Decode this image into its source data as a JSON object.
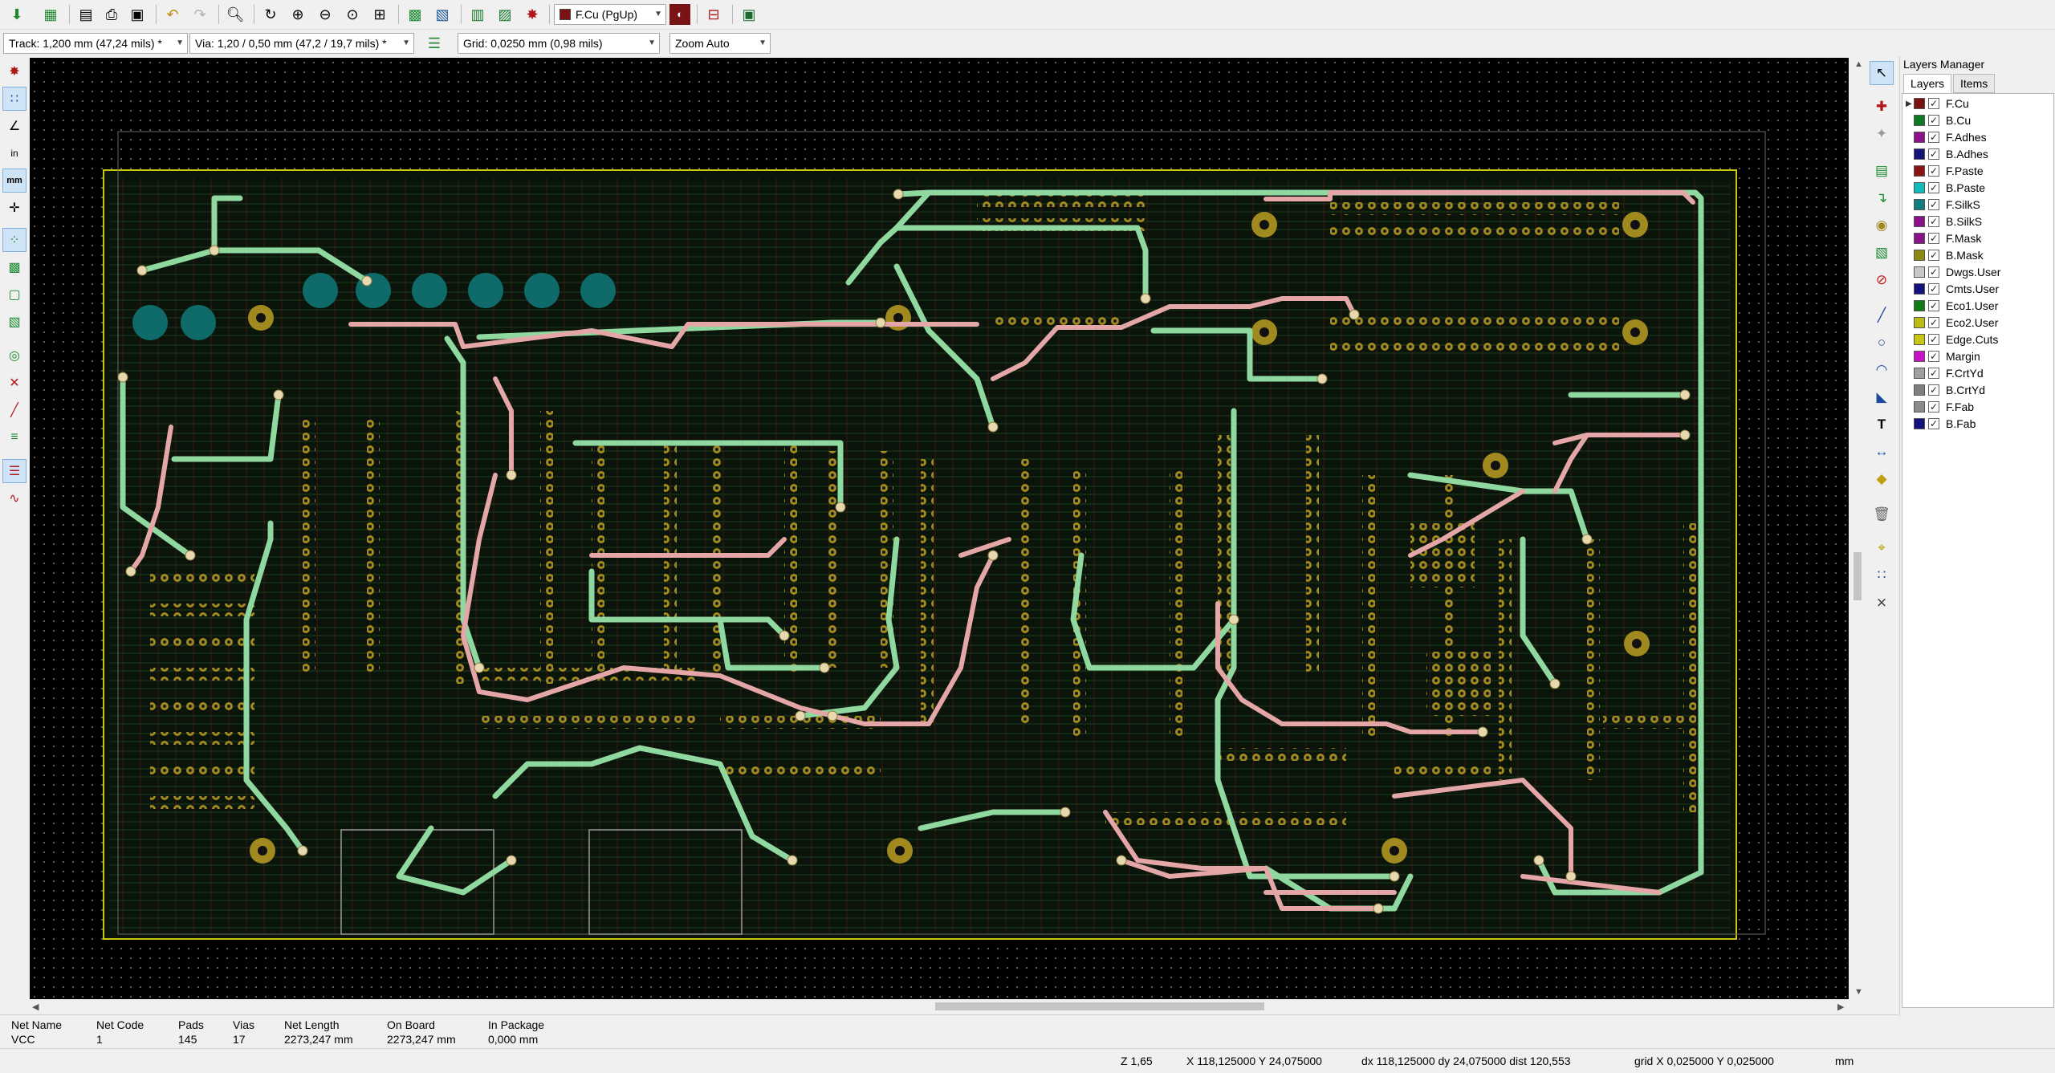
{
  "toolbar": {
    "layer_select": "F.Cu (PgUp)",
    "layer_color": "#7a1414",
    "icons": [
      "save-board-icon",
      "board-setup-icon",
      "page-settings-icon",
      "print-icon",
      "plot-icon",
      "undo-icon",
      "redo-icon",
      "find-icon",
      "redraw-icon",
      "zoom-in-icon",
      "zoom-out-icon",
      "zoom-fit-icon",
      "zoom-selection-icon",
      "netlist-icon",
      "update-from-schematic-icon",
      "footprint-editor-icon",
      "footprint-browser-icon",
      "drc-icon",
      "layer-pair-icon",
      "auto-track-width-icon",
      "scripting-console-icon"
    ]
  },
  "aux_toolbar": {
    "track_width": "Track: 1,200 mm (47,24 mils) *",
    "via_size": "Via: 1,20 / 0,50 mm (47,2 / 19,7 mils) *",
    "grid": "Grid: 0,0250 mm (0,98 mils)",
    "zoom": "Zoom Auto"
  },
  "left_toolbar": {
    "inch_label": "in",
    "mm_label": "mm"
  },
  "layers_manager": {
    "title": "Layers Manager",
    "tabs": [
      "Layers",
      "Items"
    ],
    "layers": [
      {
        "name": "F.Cu",
        "color": "#7a1010",
        "active": true
      },
      {
        "name": "B.Cu",
        "color": "#0b7a22"
      },
      {
        "name": "F.Adhes",
        "color": "#8a128a"
      },
      {
        "name": "B.Adhes",
        "color": "#14147a"
      },
      {
        "name": "F.Paste",
        "color": "#8a1414"
      },
      {
        "name": "B.Paste",
        "color": "#10bcbc"
      },
      {
        "name": "F.SilkS",
        "color": "#0f7f7f"
      },
      {
        "name": "B.SilkS",
        "color": "#8a128a"
      },
      {
        "name": "F.Mask",
        "color": "#8a128a"
      },
      {
        "name": "B.Mask",
        "color": "#8a8a12"
      },
      {
        "name": "Dwgs.User",
        "color": "#c8c8c8"
      },
      {
        "name": "Cmts.User",
        "color": "#12127a"
      },
      {
        "name": "Eco1.User",
        "color": "#127a12"
      },
      {
        "name": "Eco2.User",
        "color": "#bcbc12"
      },
      {
        "name": "Edge.Cuts",
        "color": "#c8c812"
      },
      {
        "name": "Margin",
        "color": "#c812c8"
      },
      {
        "name": "F.CrtYd",
        "color": "#a0a0a0"
      },
      {
        "name": "B.CrtYd",
        "color": "#7f7f7f"
      },
      {
        "name": "F.Fab",
        "color": "#8a8a8a"
      },
      {
        "name": "B.Fab",
        "color": "#12127a"
      }
    ]
  },
  "message_panel": {
    "columns": [
      {
        "label": "Net Name",
        "value": "VCC"
      },
      {
        "label": "Net Code",
        "value": "1"
      },
      {
        "label": "Pads",
        "value": "145"
      },
      {
        "label": "Vias",
        "value": "17"
      },
      {
        "label": "Net Length",
        "value": "2273,247 mm"
      },
      {
        "label": "On Board",
        "value": "2273,247 mm"
      },
      {
        "label": "In Package",
        "value": "0,000 mm"
      }
    ]
  },
  "status_bar": {
    "zoom": "Z 1,65",
    "cursor": "X 118,125000  Y 24,075000",
    "delta": "dx 118,125000  dy 24,075000  dist 120,553",
    "grid": "grid X 0,025000  Y 0,025000",
    "units": "mm"
  },
  "colors": {
    "canvas_bg": "#000000",
    "front_copper": "#e4a6a6",
    "back_copper": "#8fd9a0",
    "pad": "#a08a20",
    "edge_cuts": "#c8c812"
  }
}
